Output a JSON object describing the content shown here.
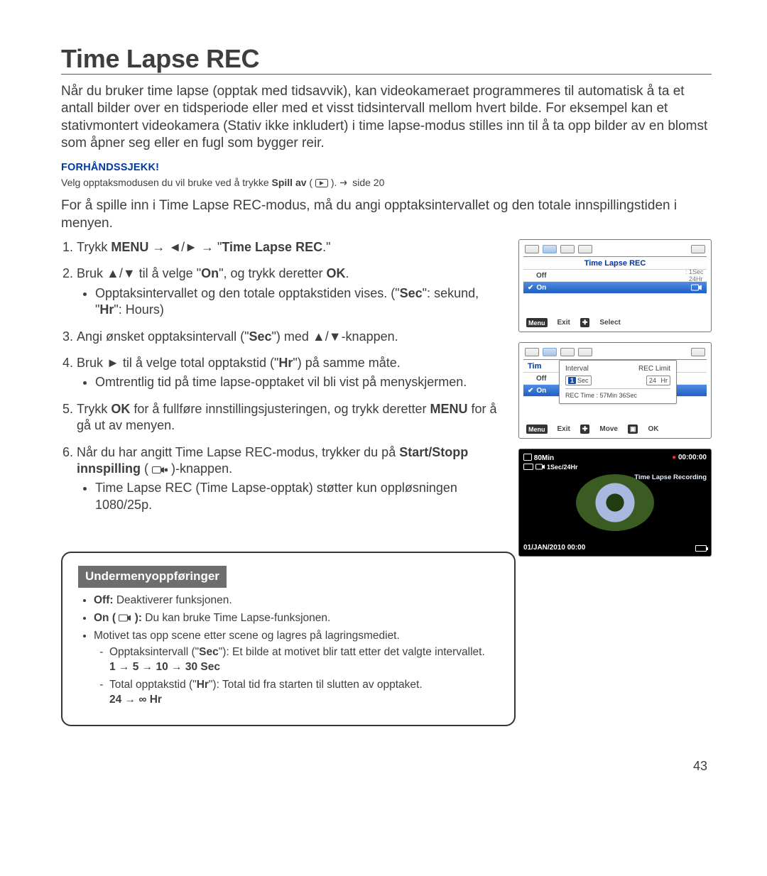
{
  "title": "Time Lapse REC",
  "intro": "Når du bruker time lapse (opptak med tidsavvik), kan videokameraet programmeres til automatisk å ta et antall bilder over en tidsperiode eller med et visst tidsintervall mellom hvert bilde. For eksempel kan et stativmontert videokamera (Stativ ikke inkludert) i time lapse-modus stilles inn til å ta opp bilder av en blomst som åpner seg eller en fugl som bygger reir.",
  "precheck": {
    "label": "FORHÅNDSSJEKK!",
    "text_a": "Velg opptaksmodusen du vil bruke ved å trykke ",
    "text_bold": "Spill av",
    "text_b": " ( ",
    "text_c": " ). ",
    "page_ref": "side 20"
  },
  "lead2": "For å spille inn i Time Lapse REC-modus, må du angi opptaksintervallet og den totale innspillingstiden i menyen.",
  "steps": {
    "s1_a": "Trykk ",
    "s1_menu": "MENU",
    "s1_b": " → ◄/► → \"",
    "s1_tlr": "Time Lapse REC",
    "s1_c": ".\"",
    "s2_a": "Bruk ▲/▼ til å velge \"",
    "s2_on": "On",
    "s2_b": "\", og trykk deretter ",
    "s2_ok": "OK",
    "s2_c": ".",
    "s2_sub": "Opptaksintervallet og den totale opptakstiden vises. (\"",
    "s2_sec": "Sec",
    "s2_sub2": "\": sekund, \"",
    "s2_hr": "Hr",
    "s2_sub3": "\": Hours)",
    "s3_a": "Angi ønsket opptaksintervall (\"",
    "s3_sec": "Sec",
    "s3_b": "\") med ▲/▼-knappen.",
    "s4_a": "Bruk ► til å velge total opptakstid (\"",
    "s4_hr": "Hr",
    "s4_b": "\") på samme måte.",
    "s4_sub": "Omtrentlig tid på time lapse-opptaket vil bli vist på menyskjermen.",
    "s5_a": "Trykk ",
    "s5_ok": "OK",
    "s5_b": " for å fullføre innstillingsjusteringen, og trykk deretter ",
    "s5_menu": "MENU",
    "s5_c": " for å gå ut av menyen.",
    "s6_a": "Når du har angitt Time Lapse REC-modus, trykker du på ",
    "s6_ss": "Start/Stopp innspilling",
    "s6_b": " (",
    "s6_c": ")-knappen.",
    "s6_sub": "Time Lapse REC (Time Lapse-opptak) støtter kun oppløsningen 1080/25p."
  },
  "lcd1": {
    "title": "Time Lapse REC",
    "off": "Off",
    "on": "On",
    "side_top": "1Sec",
    "side_bot": "24Hr",
    "exit": "Exit",
    "select": "Select",
    "menu": "Menu"
  },
  "lcd2": {
    "title": "Tim",
    "off": "Off",
    "on": "On",
    "interval_label": "Interval",
    "reclimit_label": "REC Limit",
    "interval_val": "1",
    "interval_unit": "Sec",
    "reclimit_val": "24",
    "reclimit_unit": "Hr",
    "rec_time": "REC Time : 57Min 36Sec",
    "exit": "Exit",
    "move": "Move",
    "ok": "OK",
    "menu": "Menu"
  },
  "rec": {
    "battery_min": "80Min",
    "timecode": "00:00:00",
    "interval_line": "1Sec/24Hr",
    "label": "Time Lapse Recording",
    "datestamp": "01/JAN/2010 00:00"
  },
  "submenu": {
    "heading": "Undermenyoppføringer",
    "off_bold": "Off:",
    "off_text": " Deaktiverer funksjonen.",
    "on_bold": "On (",
    "on_bold2": "):",
    "on_text": " Du kan bruke Time Lapse-funksjonen.",
    "bullet3": "Motivet tas opp scene etter scene og lagres på lagringsmediet.",
    "sub_sec_a": "Opptaksintervall (\"",
    "sub_sec_bold": "Sec",
    "sub_sec_b": "\"): Et bilde at motivet blir tatt etter det valgte intervallet.",
    "sec_seq": "1 → 5 → 10 → 30 Sec",
    "sub_hr_a": "Total opptakstid (\"",
    "sub_hr_bold": "Hr",
    "sub_hr_b": "\"): Total tid fra starten til slutten av opptaket.",
    "hr_seq": "24 → ∞ Hr"
  },
  "page_number": "43"
}
